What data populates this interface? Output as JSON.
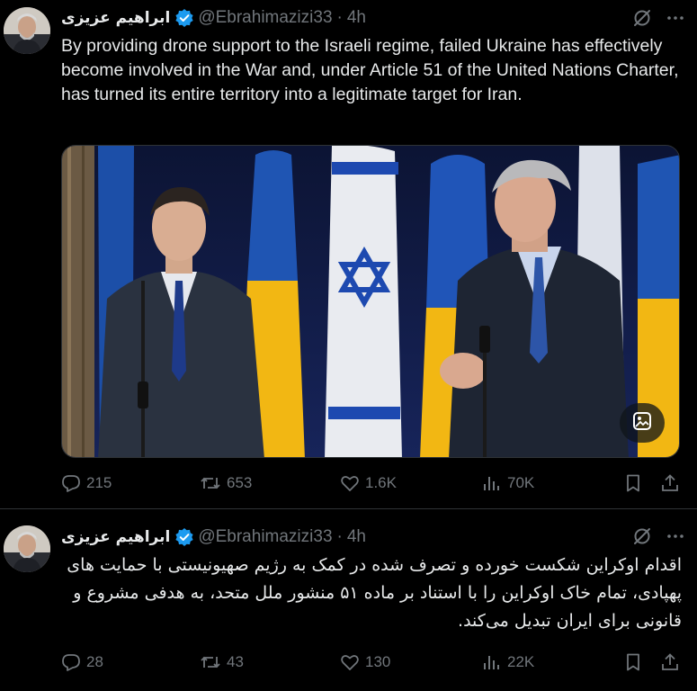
{
  "tweets": [
    {
      "author_name": "ابراهیم عزیزی",
      "handle": "@Ebrahimazizi33",
      "separator": "·",
      "time": "4h",
      "text": "By providing drone support to the Israeli regime, failed Ukraine has effectively become involved in the War and, under Article 51 of the United Nations Charter, has turned its entire territory into a legitimate target for Iran.",
      "direction": "ltr",
      "has_media": true,
      "stats": {
        "replies": "215",
        "reposts": "653",
        "likes": "1.6K",
        "views": "70K"
      }
    },
    {
      "author_name": "ابراهیم عزیزی",
      "handle": "@Ebrahimazizi33",
      "separator": "·",
      "time": "4h",
      "text": "اقدام اوکراین شکست خورده و تصرف شده در کمک به رژیم صهیونیستی با حمایت های پهپادی، تمام خاک اوکراین را با استناد بر ماده ۵۱ منشور ملل متحد، به هدفی مشروع و قانونی برای ایران تبدیل می‌کند.",
      "direction": "rtl",
      "has_media": false,
      "stats": {
        "replies": "28",
        "reposts": "43",
        "likes": "130",
        "views": "22K"
      }
    }
  ],
  "icons": {
    "verified": "verified-badge-icon",
    "grok": "grok-icon",
    "more": "more-icon",
    "reply": "reply-icon",
    "repost": "repost-icon",
    "like": "like-icon",
    "views": "views-icon",
    "bookmark": "bookmark-icon",
    "share": "share-icon",
    "media_edit": "image-edit-icon"
  },
  "colors": {
    "background": "#000000",
    "text": "#e7e9ea",
    "secondary": "#71767b",
    "verified": "#1d9bf0",
    "divider": "#2f3336",
    "flag_blue": "#1c4fa8",
    "flag_yellow": "#f2b713"
  }
}
